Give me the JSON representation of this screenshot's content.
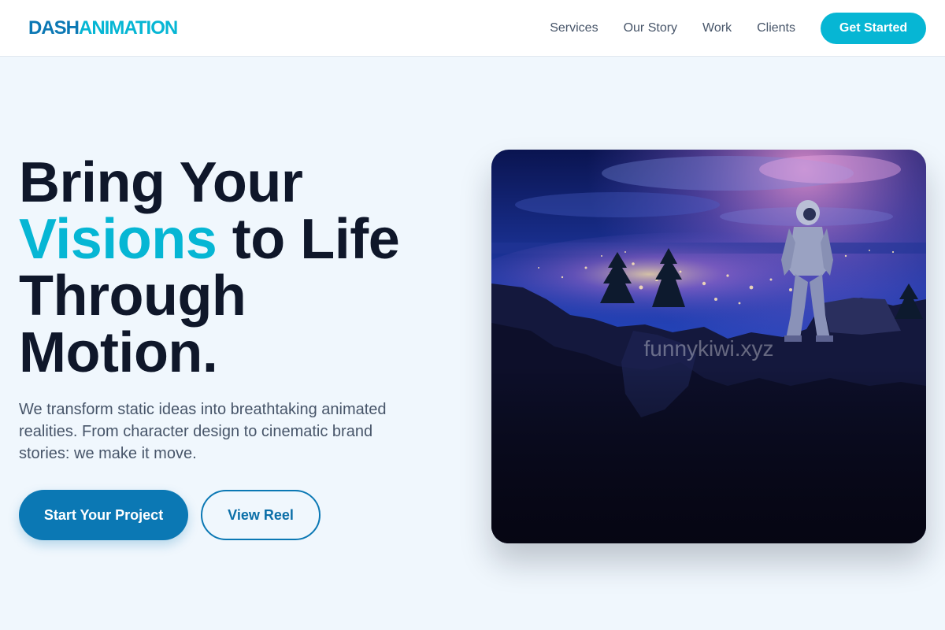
{
  "header": {
    "logo": {
      "part1": "DASH",
      "part2": "ANIMATION"
    },
    "nav": [
      {
        "label": "Services"
      },
      {
        "label": "Our Story"
      },
      {
        "label": "Work"
      },
      {
        "label": "Clients"
      }
    ],
    "cta_label": "Get Started"
  },
  "hero": {
    "title": {
      "line1": "Bring Your",
      "line2_accent": "Visions",
      "line2_rest": " to Life",
      "line3": "Through",
      "line4": "Motion."
    },
    "description": "We transform static ideas into breathtaking animated realities. From character design to cinematic brand stories: we make it move.",
    "primary_button": "Start Your Project",
    "secondary_button": "View Reel",
    "image_watermark": "funnykiwi.xyz"
  },
  "colors": {
    "brand_dark": "#0b78b4",
    "brand_accent": "#06b6d4",
    "heading": "#0f172a",
    "body_text": "#475569",
    "page_background": "#f0f7fd"
  }
}
